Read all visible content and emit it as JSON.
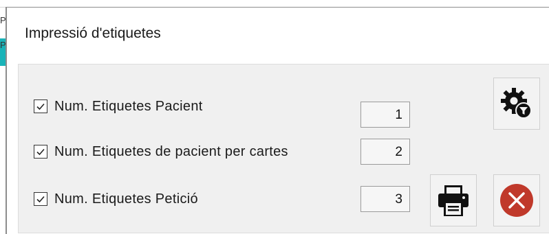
{
  "background": {
    "fragments": [
      "Pr",
      "Pr"
    ],
    "accent_color": "#19b3b8"
  },
  "dialog": {
    "title": "Impressió d'etiquetes",
    "rows": [
      {
        "label": "Num. Etiquetes Pacient",
        "checked": true,
        "value": "1"
      },
      {
        "label": "Num. Etiquetes de pacient per cartes",
        "checked": true,
        "value": "2"
      },
      {
        "label": "Num. Etiquetes Petició",
        "checked": true,
        "value": "3"
      }
    ],
    "buttons": {
      "settings_icon": "gear-filter-icon",
      "print_icon": "printer-icon",
      "close_icon": "close-circle-icon",
      "close_color": "#c0392b"
    }
  }
}
